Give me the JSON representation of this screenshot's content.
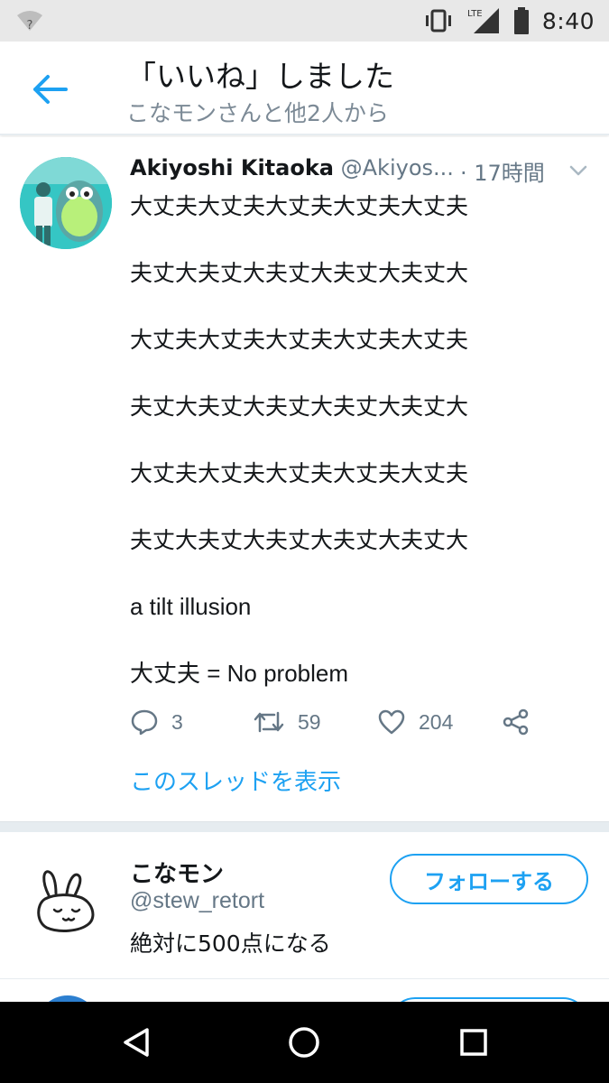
{
  "status_bar": {
    "time": "8:40",
    "network": "LTE"
  },
  "header": {
    "title": "「いいね」しました",
    "subtitle": "こなモンさんと他2人から"
  },
  "tweet": {
    "author_name": "Akiyoshi Kitaoka",
    "author_handle": "@Akiyos...",
    "time": "· 17時間",
    "lines": [
      "大丈夫大丈夫大丈夫大丈夫大丈夫",
      "夫丈大夫丈大夫丈大夫丈大夫丈大",
      "大丈夫大丈夫大丈夫大丈夫大丈夫",
      "夫丈大夫丈大夫丈大夫丈大夫丈大",
      "大丈夫大丈夫大丈夫大丈夫大丈夫",
      "夫丈大夫丈大夫丈大夫丈大夫丈大",
      "a tilt illusion",
      "大丈夫 = No problem"
    ],
    "reply_count": "3",
    "retweet_count": "59",
    "like_count": "204",
    "thread_link": "このスレッドを表示"
  },
  "user": {
    "name": "こなモン",
    "handle": "@stew_retort",
    "bio": "絶対に500点になる",
    "follow_label": "フォローする"
  },
  "colors": {
    "accent": "#1da1f2",
    "secondary_text": "#657786",
    "primary_text": "#14171a"
  }
}
